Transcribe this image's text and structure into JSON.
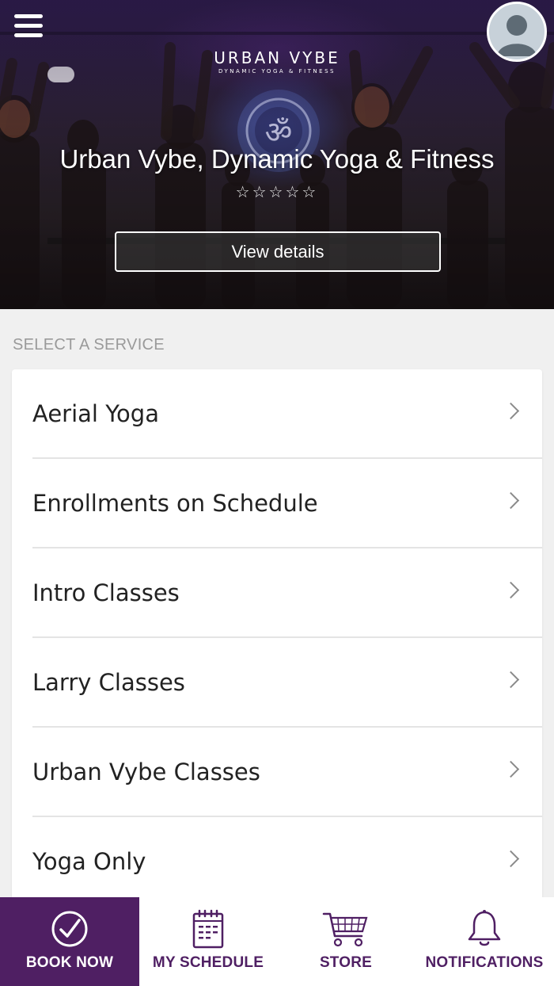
{
  "header": {
    "logo_main": "URBAN VYBE",
    "logo_sub": "DYNAMIC YOGA & FITNESS",
    "studio_name": "Urban Vybe, Dynamic Yoga & Fitness",
    "rating_stars": "☆☆☆☆☆",
    "rating": 0,
    "view_details_label": "View details"
  },
  "services": {
    "section_label": "SELECT A SERVICE",
    "items": [
      {
        "label": "Aerial Yoga"
      },
      {
        "label": "Enrollments on Schedule"
      },
      {
        "label": "Intro Classes"
      },
      {
        "label": "Larry Classes"
      },
      {
        "label": "Urban Vybe Classes"
      },
      {
        "label": "Yoga Only"
      }
    ]
  },
  "tabbar": {
    "tabs": [
      {
        "label": "BOOK NOW",
        "icon": "check-circle-icon",
        "active": true
      },
      {
        "label": "MY SCHEDULE",
        "icon": "calendar-icon",
        "active": false
      },
      {
        "label": "STORE",
        "icon": "cart-icon",
        "active": false
      },
      {
        "label": "NOTIFICATIONS",
        "icon": "bell-icon",
        "active": false
      }
    ]
  },
  "colors": {
    "brand_purple": "#4f1f63",
    "background": "#f0f0f0"
  }
}
